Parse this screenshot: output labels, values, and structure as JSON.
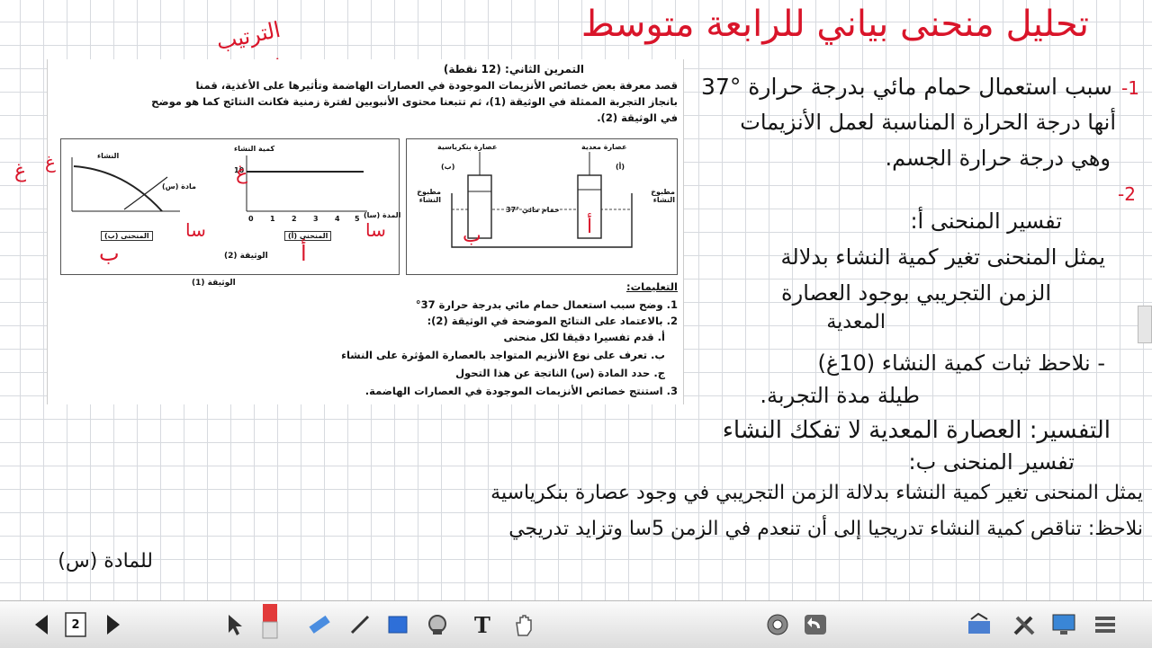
{
  "title": "تحليل منحنى بياني للرابعة متوسط",
  "corner_note": "الترتيب",
  "document": {
    "exercise_title": "التمرين الثاني: (12 نقطة)",
    "intro_1": "قصد معرفة بعض خصائص الأنزيمات الموجودة في العصارات الهاضمة وتأثيرها على الأغذية، قمنا",
    "intro_2": "بانجاز التجربة الممثلة في الوثيقة (1)، ثم تتبعنا محتوى الأنبوبين لفترة زمنية فكانت النتائج كما هو موضح",
    "intro_3": "في الوثيقة (2).",
    "doc1": {
      "label_a": "عصارة معدية",
      "label_b": "عصارة بنكرياسية",
      "tube_a": "(أ)",
      "tube_b": "(ب)",
      "starch_left": "مطبوخ النشاء",
      "starch_right": "مطبوخ النشاء",
      "bath": "حمام مائي °37",
      "caption": "الوثيقة (1)"
    },
    "doc2": {
      "ylabel": "كمية النشاء",
      "y10": "10",
      "xaxis_ticks": [
        "0",
        "1",
        "2",
        "3",
        "4",
        "5"
      ],
      "xlabel": "المدة (سا)",
      "curve_a_label": "المنحنى (أ)",
      "curve_b_label": "المنحنى (ب)",
      "starch": "النشاء",
      "substance": "مادة (س)",
      "caption": "الوثيقة (2)"
    },
    "instructions_title": "التعليمات:",
    "q1": "1. وضح سبب استعمال حمام مائي بدرجة حرارة 37°",
    "q2": "2. بالاعتماد على النتائج الموضحة في الوثيقة (2):",
    "q2a": "أ. قدم تفسيرا دقيقا لكل منحنى",
    "q2b": "ب. تعرف على نوع الأنزيم المتواجد بالعصارة المؤثرة على النشاء",
    "q2c": "ج. حدد المادة (س) الناتجة عن هذا التحول",
    "q3": "3. استنتج خصائص الأنزيمات الموجودة في العصارات الهاضمة."
  },
  "annotations": {
    "doc_marks": {
      "a": "أ",
      "b": "ب",
      "hour_1": "سا",
      "hour_2": "سا",
      "g_1": "غ",
      "g_2": "غ",
      "g_3": "غ",
      "n": "ن",
      "mark_1": "أ",
      "mark_2": "ب"
    }
  },
  "notes": {
    "n1_num": "1-",
    "n1_l1": "سبب استعمال حمام مائي بدرجة حرارة °37",
    "n1_l2": "أنها درجة الحرارة المناسبة لعمل الأنزيمات",
    "n1_l3": "وهي درجة حرارة الجسم.",
    "n2_num": "2-",
    "n2_a_title": "تفسير المنحنى أ:",
    "n2_a_l1": "يمثل المنحنى تغير كمية النشاء بدلالة",
    "n2_a_l2": "الزمن التجريبي بوجود العصارة",
    "n2_a_l3": "المعدية",
    "n2_a_l4": "- نلاحظ ثبات كمية النشاء (10غ)",
    "n2_a_l5": "طيلة مدة التجربة.",
    "n2_a_l6": "التفسير: العصارة المعدية لا تفكك النشاء",
    "n2_b_title": "تفسير المنحنى ب:",
    "n2_b_l1": "يمثل المنحنى تغير كمية النشاء بدلالة الزمن التجريبي في وجود عصارة بنكرياسية",
    "n2_b_l2": "نلاحظ: تناقص كمية النشاء تدريجيا إلى أن تنعدم في الزمن 5سا وتزايد تدريجي",
    "n2_b_l3": "للمادة (س)"
  },
  "toolbar": {
    "page_number": "2",
    "icons": [
      "prev-page-icon",
      "page-icon",
      "next-page-icon",
      "select-arrow-icon",
      "eraser-pen-icon",
      "highlighter-icon",
      "pen-icon",
      "rectangle-icon",
      "fill-icon",
      "text-icon",
      "hand-icon",
      "screen-capture-icon",
      "undo-icon",
      "keyboard-icon",
      "tools-icon",
      "display-icon",
      "menu-icon"
    ]
  },
  "colors": {
    "ink_red": "#d9152a",
    "ink_black": "#151515",
    "grid": "#d7dadf",
    "toolbar": "#dcdcdc"
  }
}
